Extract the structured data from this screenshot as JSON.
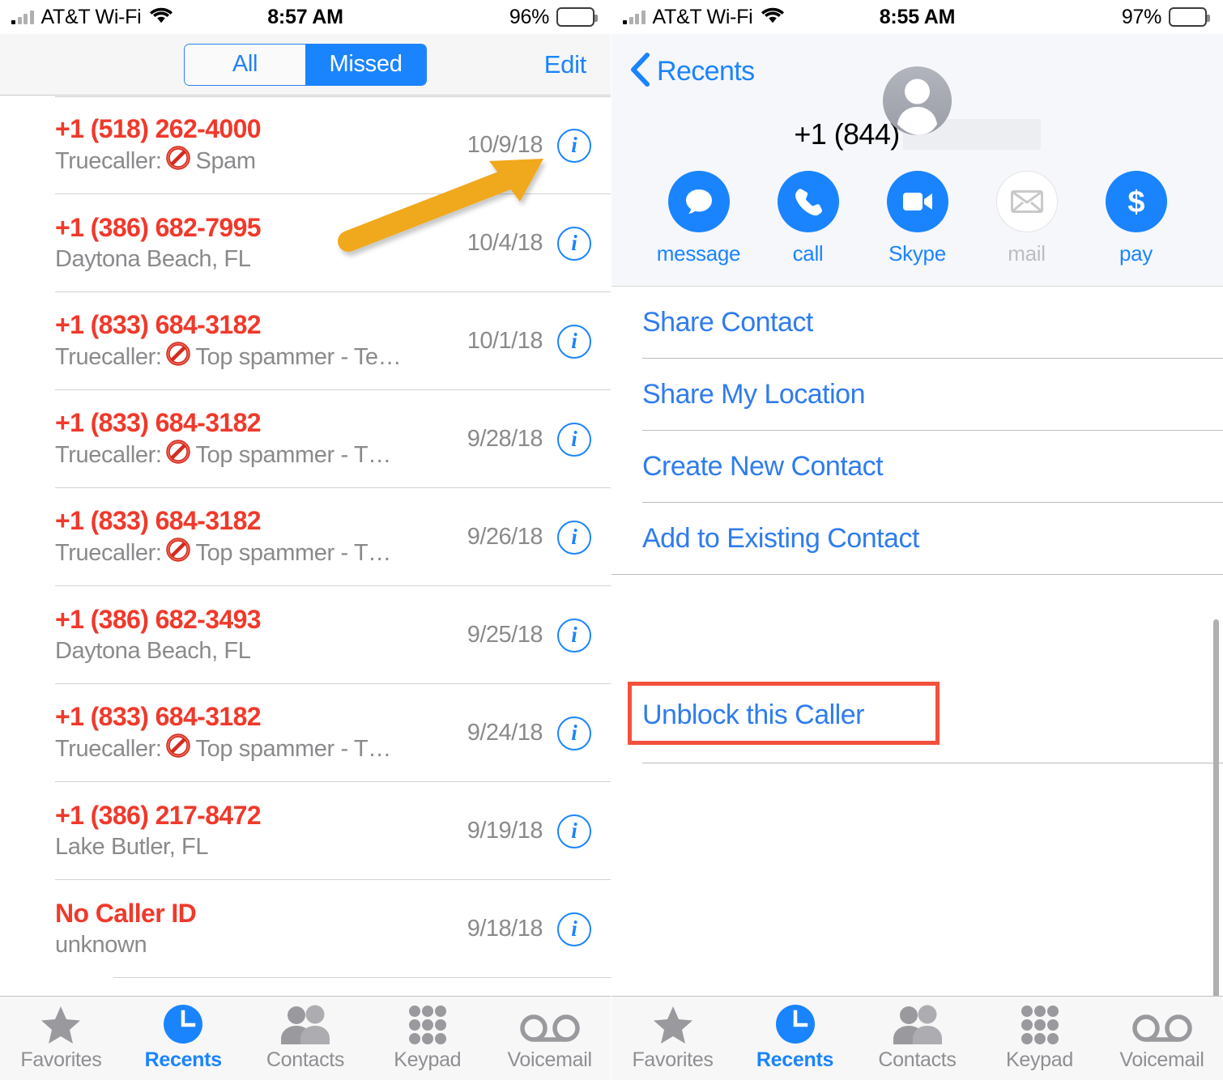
{
  "left": {
    "status": {
      "carrier": "AT&T Wi-Fi",
      "time": "8:57 AM",
      "battery": "96%",
      "wifi_icon": "wifi-icon",
      "signal_icon": "signal-bars-icon",
      "battery_icon": "battery-icon"
    },
    "nav": {
      "segment_all": "All",
      "segment_missed": "Missed",
      "selected_segment": "Missed",
      "edit": "Edit"
    },
    "calls": [
      {
        "number": "+1 (518) 262-4000",
        "sub_prefix": "Truecaller:",
        "has_ban_icon": true,
        "sub_suffix": "Spam",
        "date": "10/9/18",
        "info": "i"
      },
      {
        "number": "+1 (386) 682-7995",
        "sub_prefix": "Daytona Beach, FL",
        "has_ban_icon": false,
        "sub_suffix": "",
        "date": "10/4/18",
        "info": "i"
      },
      {
        "number": "+1 (833) 684-3182",
        "sub_prefix": "Truecaller:",
        "has_ban_icon": true,
        "sub_suffix": "Top spammer - Te…",
        "date": "10/1/18",
        "info": "i"
      },
      {
        "number": "+1 (833) 684-3182",
        "sub_prefix": "Truecaller:",
        "has_ban_icon": true,
        "sub_suffix": "Top spammer - T…",
        "date": "9/28/18",
        "info": "i"
      },
      {
        "number": "+1 (833) 684-3182",
        "sub_prefix": "Truecaller:",
        "has_ban_icon": true,
        "sub_suffix": "Top spammer - T…",
        "date": "9/26/18",
        "info": "i"
      },
      {
        "number": "+1 (386) 682-3493",
        "sub_prefix": "Daytona Beach, FL",
        "has_ban_icon": false,
        "sub_suffix": "",
        "date": "9/25/18",
        "info": "i"
      },
      {
        "number": "+1 (833) 684-3182",
        "sub_prefix": "Truecaller:",
        "has_ban_icon": true,
        "sub_suffix": "Top spammer - T…",
        "date": "9/24/18",
        "info": "i"
      },
      {
        "number": "+1 (386) 217-8472",
        "sub_prefix": "Lake Butler, FL",
        "has_ban_icon": false,
        "sub_suffix": "",
        "date": "9/19/18",
        "info": "i"
      },
      {
        "number": "No Caller ID",
        "sub_prefix": "unknown",
        "has_ban_icon": false,
        "sub_suffix": "",
        "date": "9/18/18",
        "info": "i"
      }
    ],
    "tabs": [
      {
        "label": "Favorites",
        "icon": "star-icon",
        "active": false
      },
      {
        "label": "Recents",
        "icon": "clock-icon",
        "active": true
      },
      {
        "label": "Contacts",
        "icon": "people-icon",
        "active": false
      },
      {
        "label": "Keypad",
        "icon": "keypad-icon",
        "active": false
      },
      {
        "label": "Voicemail",
        "icon": "voicemail-icon",
        "active": false
      }
    ],
    "annotation": {
      "type": "arrow",
      "color": "#f0a81c",
      "points_to": "info-button-row-1"
    }
  },
  "right": {
    "status": {
      "carrier": "AT&T Wi-Fi",
      "time": "8:55 AM",
      "battery": "97%",
      "wifi_icon": "wifi-icon",
      "signal_icon": "signal-bars-icon",
      "battery_icon": "battery-icon"
    },
    "nav": {
      "back_label": "Recents",
      "back_icon": "chevron-left-icon"
    },
    "contact": {
      "number": "+1 (844)",
      "redacted": true,
      "avatar_icon": "person-placeholder-icon"
    },
    "actions": [
      {
        "label": "message",
        "icon": "message-bubble-icon",
        "disabled": false
      },
      {
        "label": "call",
        "icon": "phone-handset-icon",
        "disabled": false
      },
      {
        "label": "Skype",
        "icon": "video-camera-icon",
        "disabled": false
      },
      {
        "label": "mail",
        "icon": "envelope-icon",
        "disabled": true
      },
      {
        "label": "pay",
        "icon": "dollar-sign-icon",
        "disabled": false
      }
    ],
    "menu": [
      {
        "label": "Share Contact"
      },
      {
        "label": "Share My Location"
      },
      {
        "label": "Create New Contact"
      },
      {
        "label": "Add to Existing Contact"
      }
    ],
    "unblock": {
      "label": "Unblock this Caller",
      "highlight_color": "#f4503c"
    },
    "tabs": [
      {
        "label": "Favorites",
        "icon": "star-icon",
        "active": false
      },
      {
        "label": "Recents",
        "icon": "clock-icon",
        "active": true
      },
      {
        "label": "Contacts",
        "icon": "people-icon",
        "active": false
      },
      {
        "label": "Keypad",
        "icon": "keypad-icon",
        "active": false
      },
      {
        "label": "Voicemail",
        "icon": "voicemail-icon",
        "active": false
      }
    ]
  },
  "colors": {
    "accent_blue": "#1a84ff",
    "spam_red": "#f0392b",
    "annotation_orange": "#f0a81c",
    "highlight_red": "#f4503c",
    "secondary_gray": "#8a8a8d"
  }
}
